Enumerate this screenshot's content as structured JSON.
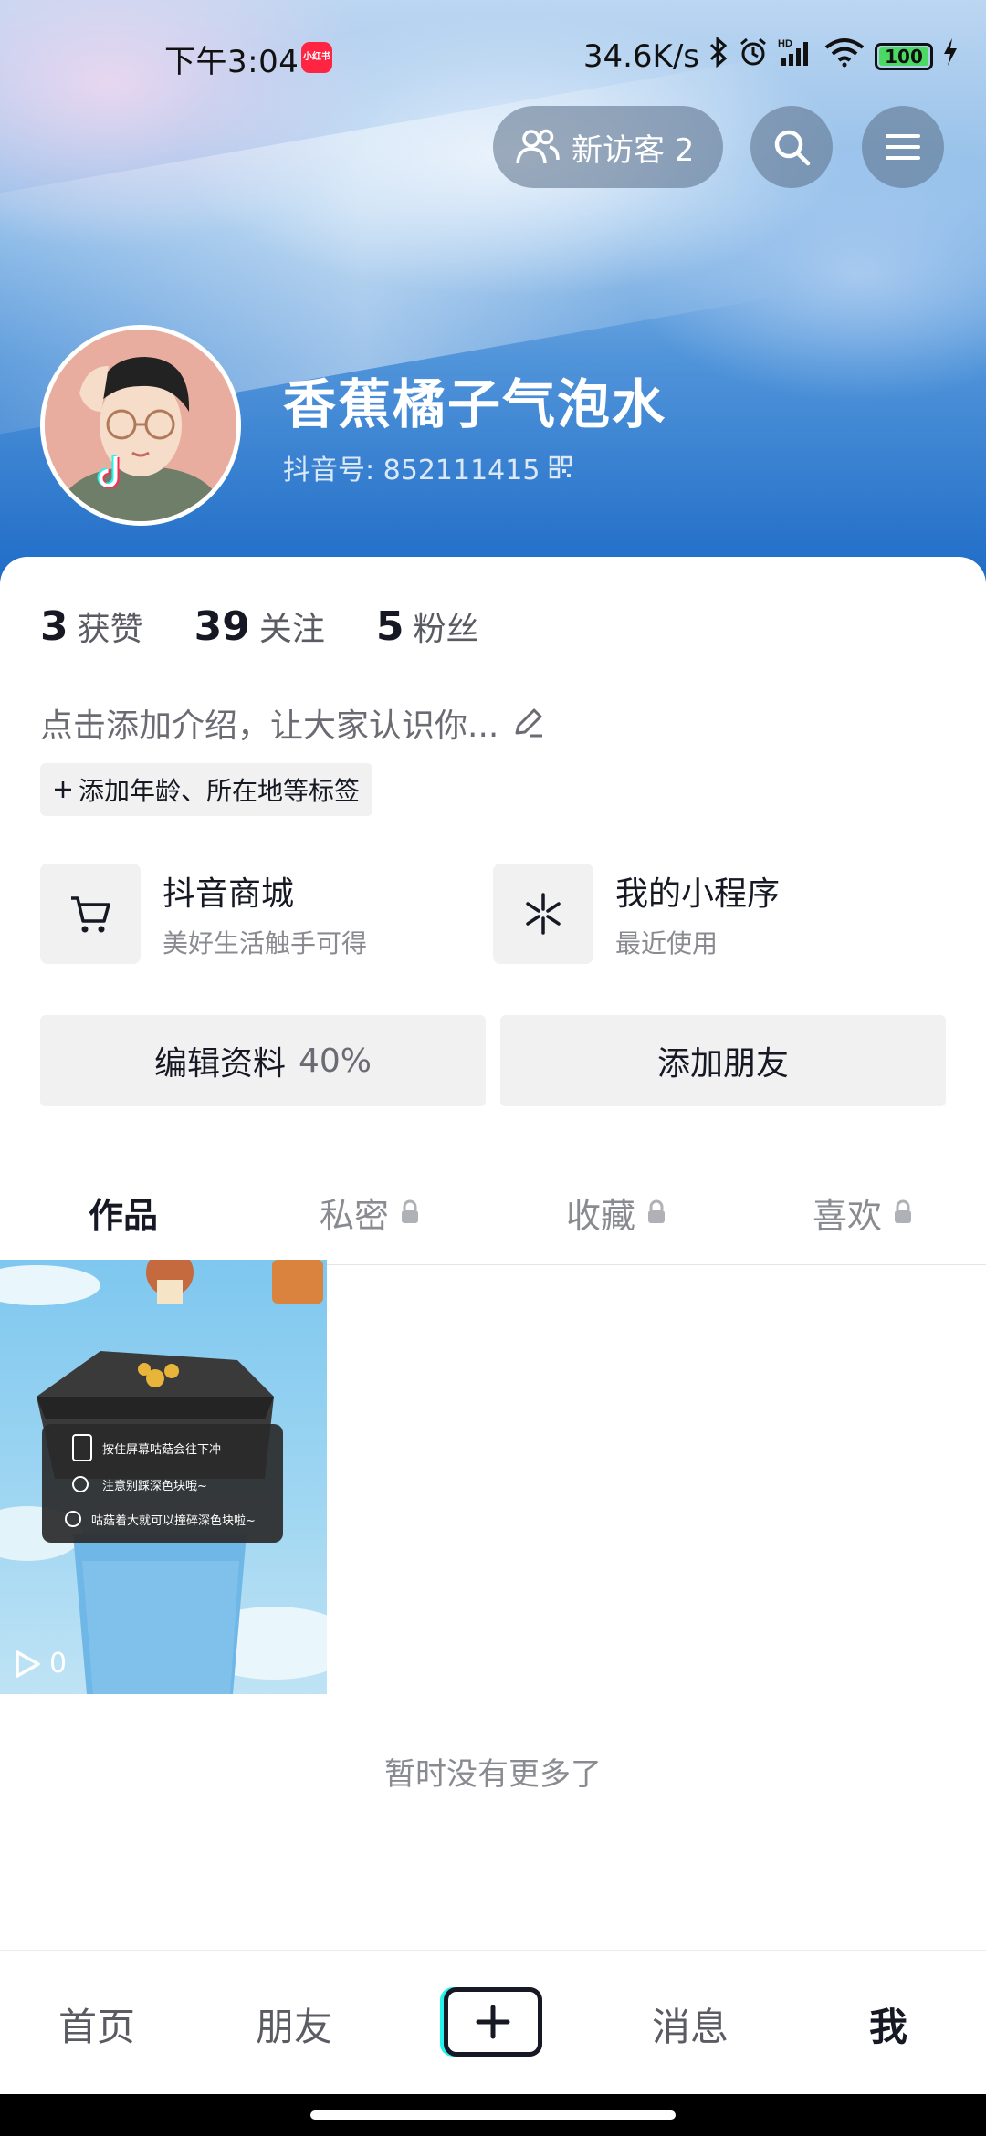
{
  "status_bar": {
    "time": "下午3:04",
    "app_badge": "小红书",
    "network_speed": "34.6K/s",
    "battery": "100"
  },
  "header": {
    "visitor_label": "新访客 2"
  },
  "profile": {
    "name": "香蕉橘子气泡水",
    "douyin_id": "抖音号: 852111415"
  },
  "stats": [
    {
      "value": "3",
      "label": "获赞"
    },
    {
      "value": "39",
      "label": "关注"
    },
    {
      "value": "5",
      "label": "粉丝"
    }
  ],
  "bio": {
    "placeholder": "点击添加介绍，让大家认识你..."
  },
  "tag_chip": {
    "label": "添加年龄、所在地等标签"
  },
  "features": [
    {
      "title": "抖音商城",
      "subtitle": "美好生活触手可得",
      "icon": "cart-icon"
    },
    {
      "title": "我的小程序",
      "subtitle": "最近使用",
      "icon": "mini-program-icon"
    }
  ],
  "actions": {
    "edit_label": "编辑资料",
    "edit_progress": "40%",
    "add_friend_label": "添加朋友"
  },
  "tabs": [
    {
      "label": "作品",
      "locked": false,
      "active": true
    },
    {
      "label": "私密",
      "locked": true,
      "active": false
    },
    {
      "label": "收藏",
      "locked": true,
      "active": false
    },
    {
      "label": "喜欢",
      "locked": true,
      "active": false
    }
  ],
  "video": {
    "play_count": "0",
    "overlay_lines": [
      "按住屏幕咕菇会往下冲",
      "注意别踩深色块哦~",
      "咕菇着大就可以撞碎深色块啦~"
    ]
  },
  "list_end_text": "暂时没有更多了",
  "bottom_nav": {
    "home": "首页",
    "friends": "朋友",
    "messages": "消息",
    "me": "我"
  }
}
